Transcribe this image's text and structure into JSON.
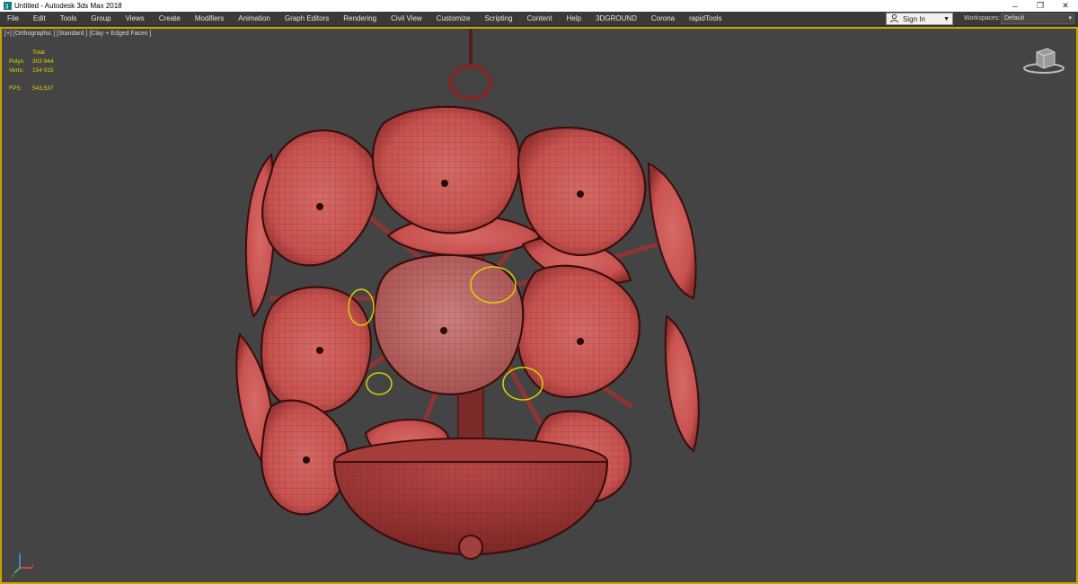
{
  "window": {
    "title": "Untitled - Autodesk 3ds Max 2018",
    "controls": {
      "minimize": "─",
      "restore": "❐",
      "close": "✕"
    }
  },
  "menu": {
    "items": [
      "File",
      "Edit",
      "Tools",
      "Group",
      "Views",
      "Create",
      "Modifiers",
      "Animation",
      "Graph Editors",
      "Rendering",
      "Civil View",
      "Customize",
      "Scripting",
      "Content",
      "Help",
      "3DGROUND",
      "Corona",
      "rapidTools"
    ],
    "sign_in": "Sign In",
    "workspaces_label": "Workspaces:",
    "workspace_value": "Default"
  },
  "viewport": {
    "label": "[+] [Orthographic ] [Standard ] [Clay + Edged Faces ]",
    "stats": {
      "header": "Total",
      "polys_label": "Polys:",
      "polys_value": "303 944",
      "verts_label": "Verts:",
      "verts_value": "154 015",
      "fps_label": "FPS:",
      "fps_value": "543,537"
    },
    "border_color": "#c6a300",
    "model_color": "#c8524f"
  },
  "icons": {
    "app": "3dsmax-icon",
    "user": "user-icon",
    "viewcube": "viewcube-icon",
    "axis": "axis-tripod-icon"
  }
}
